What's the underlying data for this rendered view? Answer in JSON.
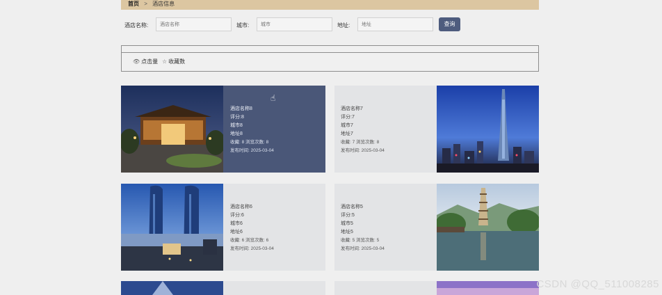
{
  "breadcrumb": {
    "home": "首页",
    "separator": ">",
    "current": "酒店信息"
  },
  "search": {
    "name_label": "酒店名称:",
    "name_placeholder": "酒店名称",
    "city_label": "城市:",
    "city_placeholder": "城市",
    "address_label": "地址:",
    "address_placeholder": "地址",
    "button_label": "查询"
  },
  "sort": {
    "clicks_label": "点击量",
    "favorites_label": "收藏数"
  },
  "cards": [
    {
      "name": "酒店名称8",
      "score": "评分:8",
      "city": "城市8",
      "address": "地址8",
      "stats": "收藏: 8 浏览次数: 8",
      "published": "发布时间: 2025-03-04"
    },
    {
      "name": "酒店名称7",
      "score": "评分:7",
      "city": "城市7",
      "address": "地址7",
      "stats": "收藏: 7 浏览次数: 8",
      "published": "发布时间: 2025-03-04"
    },
    {
      "name": "酒店名称6",
      "score": "评分:6",
      "city": "城市6",
      "address": "地址6",
      "stats": "收藏: 6 浏览次数: 6",
      "published": "发布时间: 2025-03-04"
    },
    {
      "name": "酒店名称5",
      "score": "评分:5",
      "city": "城市5",
      "address": "地址5",
      "stats": "收藏: 5 浏览次数: 5",
      "published": "发布时间: 2025-03-04"
    }
  ],
  "watermark": "CSDN @QQ_511008285",
  "colors": {
    "breadcrumb_bg": "#dcc6a1",
    "button_bg": "#4e5c7e",
    "card_active_bg": "#4a5778",
    "card_bg": "#e3e4e6"
  }
}
